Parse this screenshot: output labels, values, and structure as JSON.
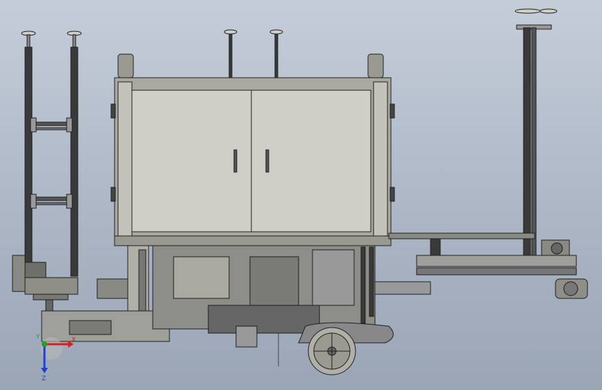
{
  "viewport": {
    "background_top": "#c5cdd9",
    "background_bottom": "#9aa5b6",
    "view": "front"
  },
  "model": {
    "line_color": "#1e1e1e",
    "frame_color": "#b9b8b0",
    "cabinet_color": "#cfcfc7",
    "wheel_color": "#b0b0a8"
  },
  "triad": {
    "x_label": "X",
    "y_label": "Y",
    "z_label": "Z",
    "x_color": "#d42020",
    "y_color": "#1fa31f",
    "z_color": "#1f3fcf"
  }
}
